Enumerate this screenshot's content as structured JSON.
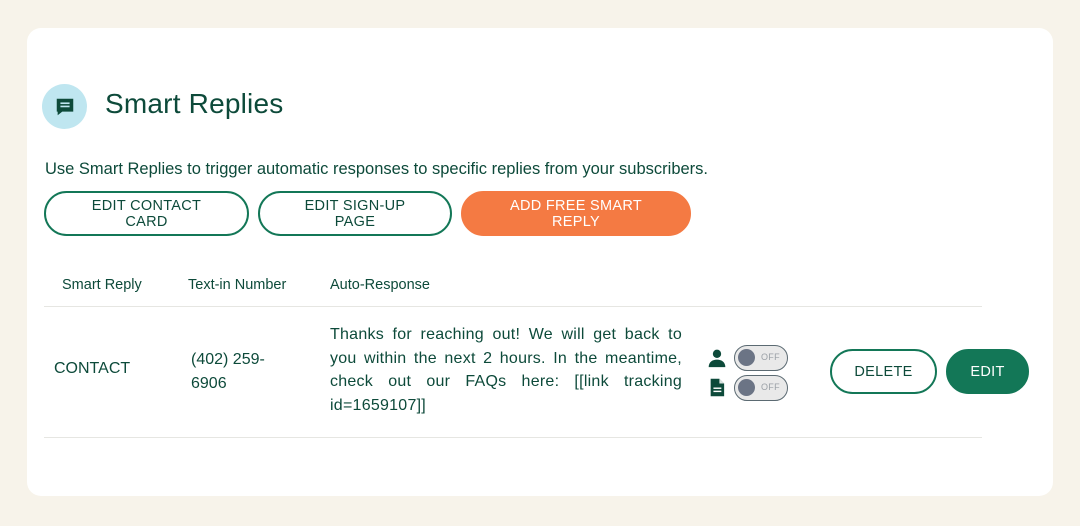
{
  "header": {
    "title": "Smart Replies",
    "icon": "chat-message-icon",
    "icon_bg": "#bfe6f0"
  },
  "description": "Use Smart Replies to trigger automatic responses to specific replies from your subscribers.",
  "toolbar": {
    "edit_contact_card": "EDIT CONTACT CARD",
    "edit_signup_page": "EDIT SIGN-UP PAGE",
    "add_free_smart_reply": "ADD FREE SMART REPLY"
  },
  "table": {
    "columns": [
      "Smart Reply",
      "Text-in Number",
      "Auto-Response"
    ],
    "rows": [
      {
        "smart_reply": "CONTACT",
        "text_in_number": "(402) 259-6906",
        "auto_response": "Thanks for reaching out! We will get back to you within the next 2 hours. In the meantime, check out our FAQs here: [[link tracking id=1659107]]",
        "contact_toggle": {
          "icon": "person-icon",
          "state": "OFF"
        },
        "document_toggle": {
          "icon": "document-icon",
          "state": "OFF"
        },
        "delete_label": "DELETE",
        "edit_label": "EDIT"
      }
    ]
  },
  "colors": {
    "primary_text": "#0d4a3a",
    "accent_green": "#137757",
    "accent_orange": "#f47a43",
    "background": "#f7f3ea"
  }
}
